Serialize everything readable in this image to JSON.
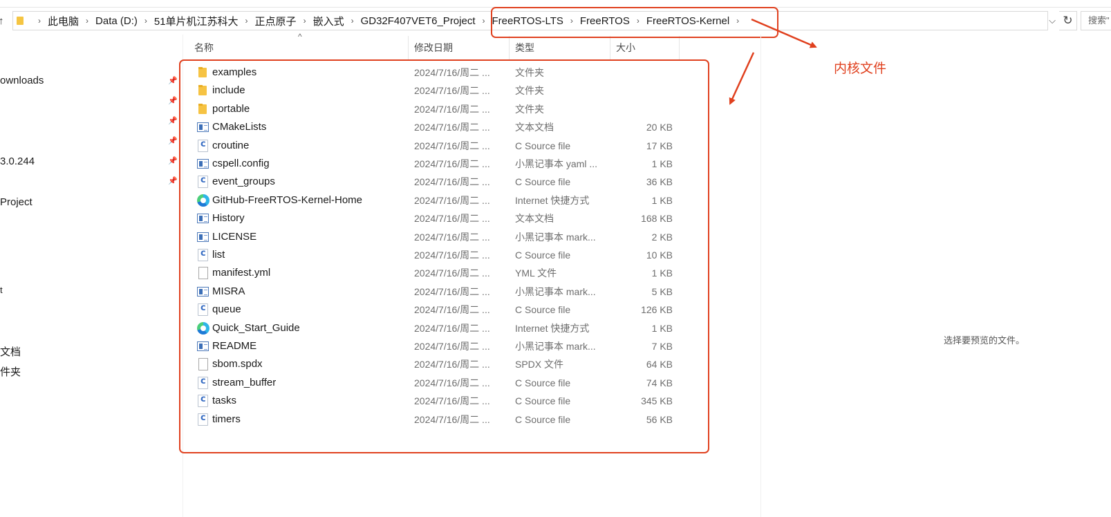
{
  "address_bar": {
    "crumbs": [
      "此电脑",
      "Data (D:)",
      "51单片机江苏科大",
      "正点原子",
      "嵌入式",
      "GD32F407VET6_Project",
      "FreeRTOS-LTS",
      "FreeRTOS",
      "FreeRTOS-Kernel"
    ],
    "search_placeholder": "搜索\""
  },
  "nav": {
    "items": [
      "ownloads",
      "3.0.244",
      "Project",
      "t",
      "文档",
      "件夹"
    ]
  },
  "columns": {
    "name": "名称",
    "modified": "修改日期",
    "type": "类型",
    "size": "大小"
  },
  "files": [
    {
      "name": "examples",
      "date": "2024/7/16/周二 ...",
      "type": "文件夹",
      "size": "",
      "icon": "folder-icon"
    },
    {
      "name": "include",
      "date": "2024/7/16/周二 ...",
      "type": "文件夹",
      "size": "",
      "icon": "folder-icon"
    },
    {
      "name": "portable",
      "date": "2024/7/16/周二 ...",
      "type": "文件夹",
      "size": "",
      "icon": "folder-icon"
    },
    {
      "name": "CMakeLists",
      "date": "2024/7/16/周二 ...",
      "type": "文本文档",
      "size": "20 KB",
      "icon": "text-file-icon"
    },
    {
      "name": "croutine",
      "date": "2024/7/16/周二 ...",
      "type": "C Source file",
      "size": "17 KB",
      "icon": "c-source-icon"
    },
    {
      "name": "cspell.config",
      "date": "2024/7/16/周二 ...",
      "type": "小黑记事本 yaml ...",
      "size": "1 KB",
      "icon": "text-file-icon"
    },
    {
      "name": "event_groups",
      "date": "2024/7/16/周二 ...",
      "type": "C Source file",
      "size": "36 KB",
      "icon": "c-source-icon"
    },
    {
      "name": "GitHub-FreeRTOS-Kernel-Home",
      "date": "2024/7/16/周二 ...",
      "type": "Internet 快捷方式",
      "size": "1 KB",
      "icon": "edge-shortcut-icon"
    },
    {
      "name": "History",
      "date": "2024/7/16/周二 ...",
      "type": "文本文档",
      "size": "168 KB",
      "icon": "text-file-icon"
    },
    {
      "name": "LICENSE",
      "date": "2024/7/16/周二 ...",
      "type": "小黑记事本 mark...",
      "size": "2 KB",
      "icon": "text-file-icon"
    },
    {
      "name": "list",
      "date": "2024/7/16/周二 ...",
      "type": "C Source file",
      "size": "10 KB",
      "icon": "c-source-icon"
    },
    {
      "name": "manifest.yml",
      "date": "2024/7/16/周二 ...",
      "type": "YML 文件",
      "size": "1 KB",
      "icon": "blank-file-icon"
    },
    {
      "name": "MISRA",
      "date": "2024/7/16/周二 ...",
      "type": "小黑记事本 mark...",
      "size": "5 KB",
      "icon": "text-file-icon"
    },
    {
      "name": "queue",
      "date": "2024/7/16/周二 ...",
      "type": "C Source file",
      "size": "126 KB",
      "icon": "c-source-icon"
    },
    {
      "name": "Quick_Start_Guide",
      "date": "2024/7/16/周二 ...",
      "type": "Internet 快捷方式",
      "size": "1 KB",
      "icon": "edge-shortcut-icon"
    },
    {
      "name": "README",
      "date": "2024/7/16/周二 ...",
      "type": "小黑记事本 mark...",
      "size": "7 KB",
      "icon": "text-file-icon"
    },
    {
      "name": "sbom.spdx",
      "date": "2024/7/16/周二 ...",
      "type": "SPDX 文件",
      "size": "64 KB",
      "icon": "blank-file-icon"
    },
    {
      "name": "stream_buffer",
      "date": "2024/7/16/周二 ...",
      "type": "C Source file",
      "size": "74 KB",
      "icon": "c-source-icon"
    },
    {
      "name": "tasks",
      "date": "2024/7/16/周二 ...",
      "type": "C Source file",
      "size": "345 KB",
      "icon": "c-source-icon"
    },
    {
      "name": "timers",
      "date": "2024/7/16/周二 ...",
      "type": "C Source file",
      "size": "56 KB",
      "icon": "c-source-icon"
    }
  ],
  "annotation": {
    "label": "内核文件",
    "color": "#e0401e"
  },
  "preview": {
    "message": "选择要预览的文件。"
  }
}
